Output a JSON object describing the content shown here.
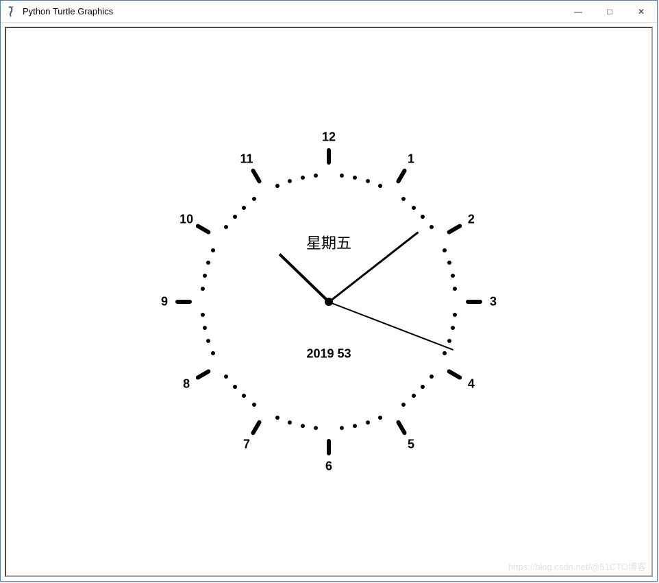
{
  "window": {
    "title": "Python Turtle Graphics",
    "minimize": "—",
    "maximize": "□",
    "close": "✕"
  },
  "clock": {
    "numbers": [
      "12",
      "1",
      "2",
      "3",
      "4",
      "5",
      "6",
      "7",
      "8",
      "9",
      "10",
      "11"
    ],
    "weekday": "星期五",
    "date_text": "2019  53",
    "hour_angle": 314,
    "minute_angle": 52,
    "second_angle": 111,
    "radius_tick_outer": 200,
    "radius_dot": 185,
    "radius_num": 240
  },
  "watermark": "https://blog.csdn.net/@51CTO博客"
}
